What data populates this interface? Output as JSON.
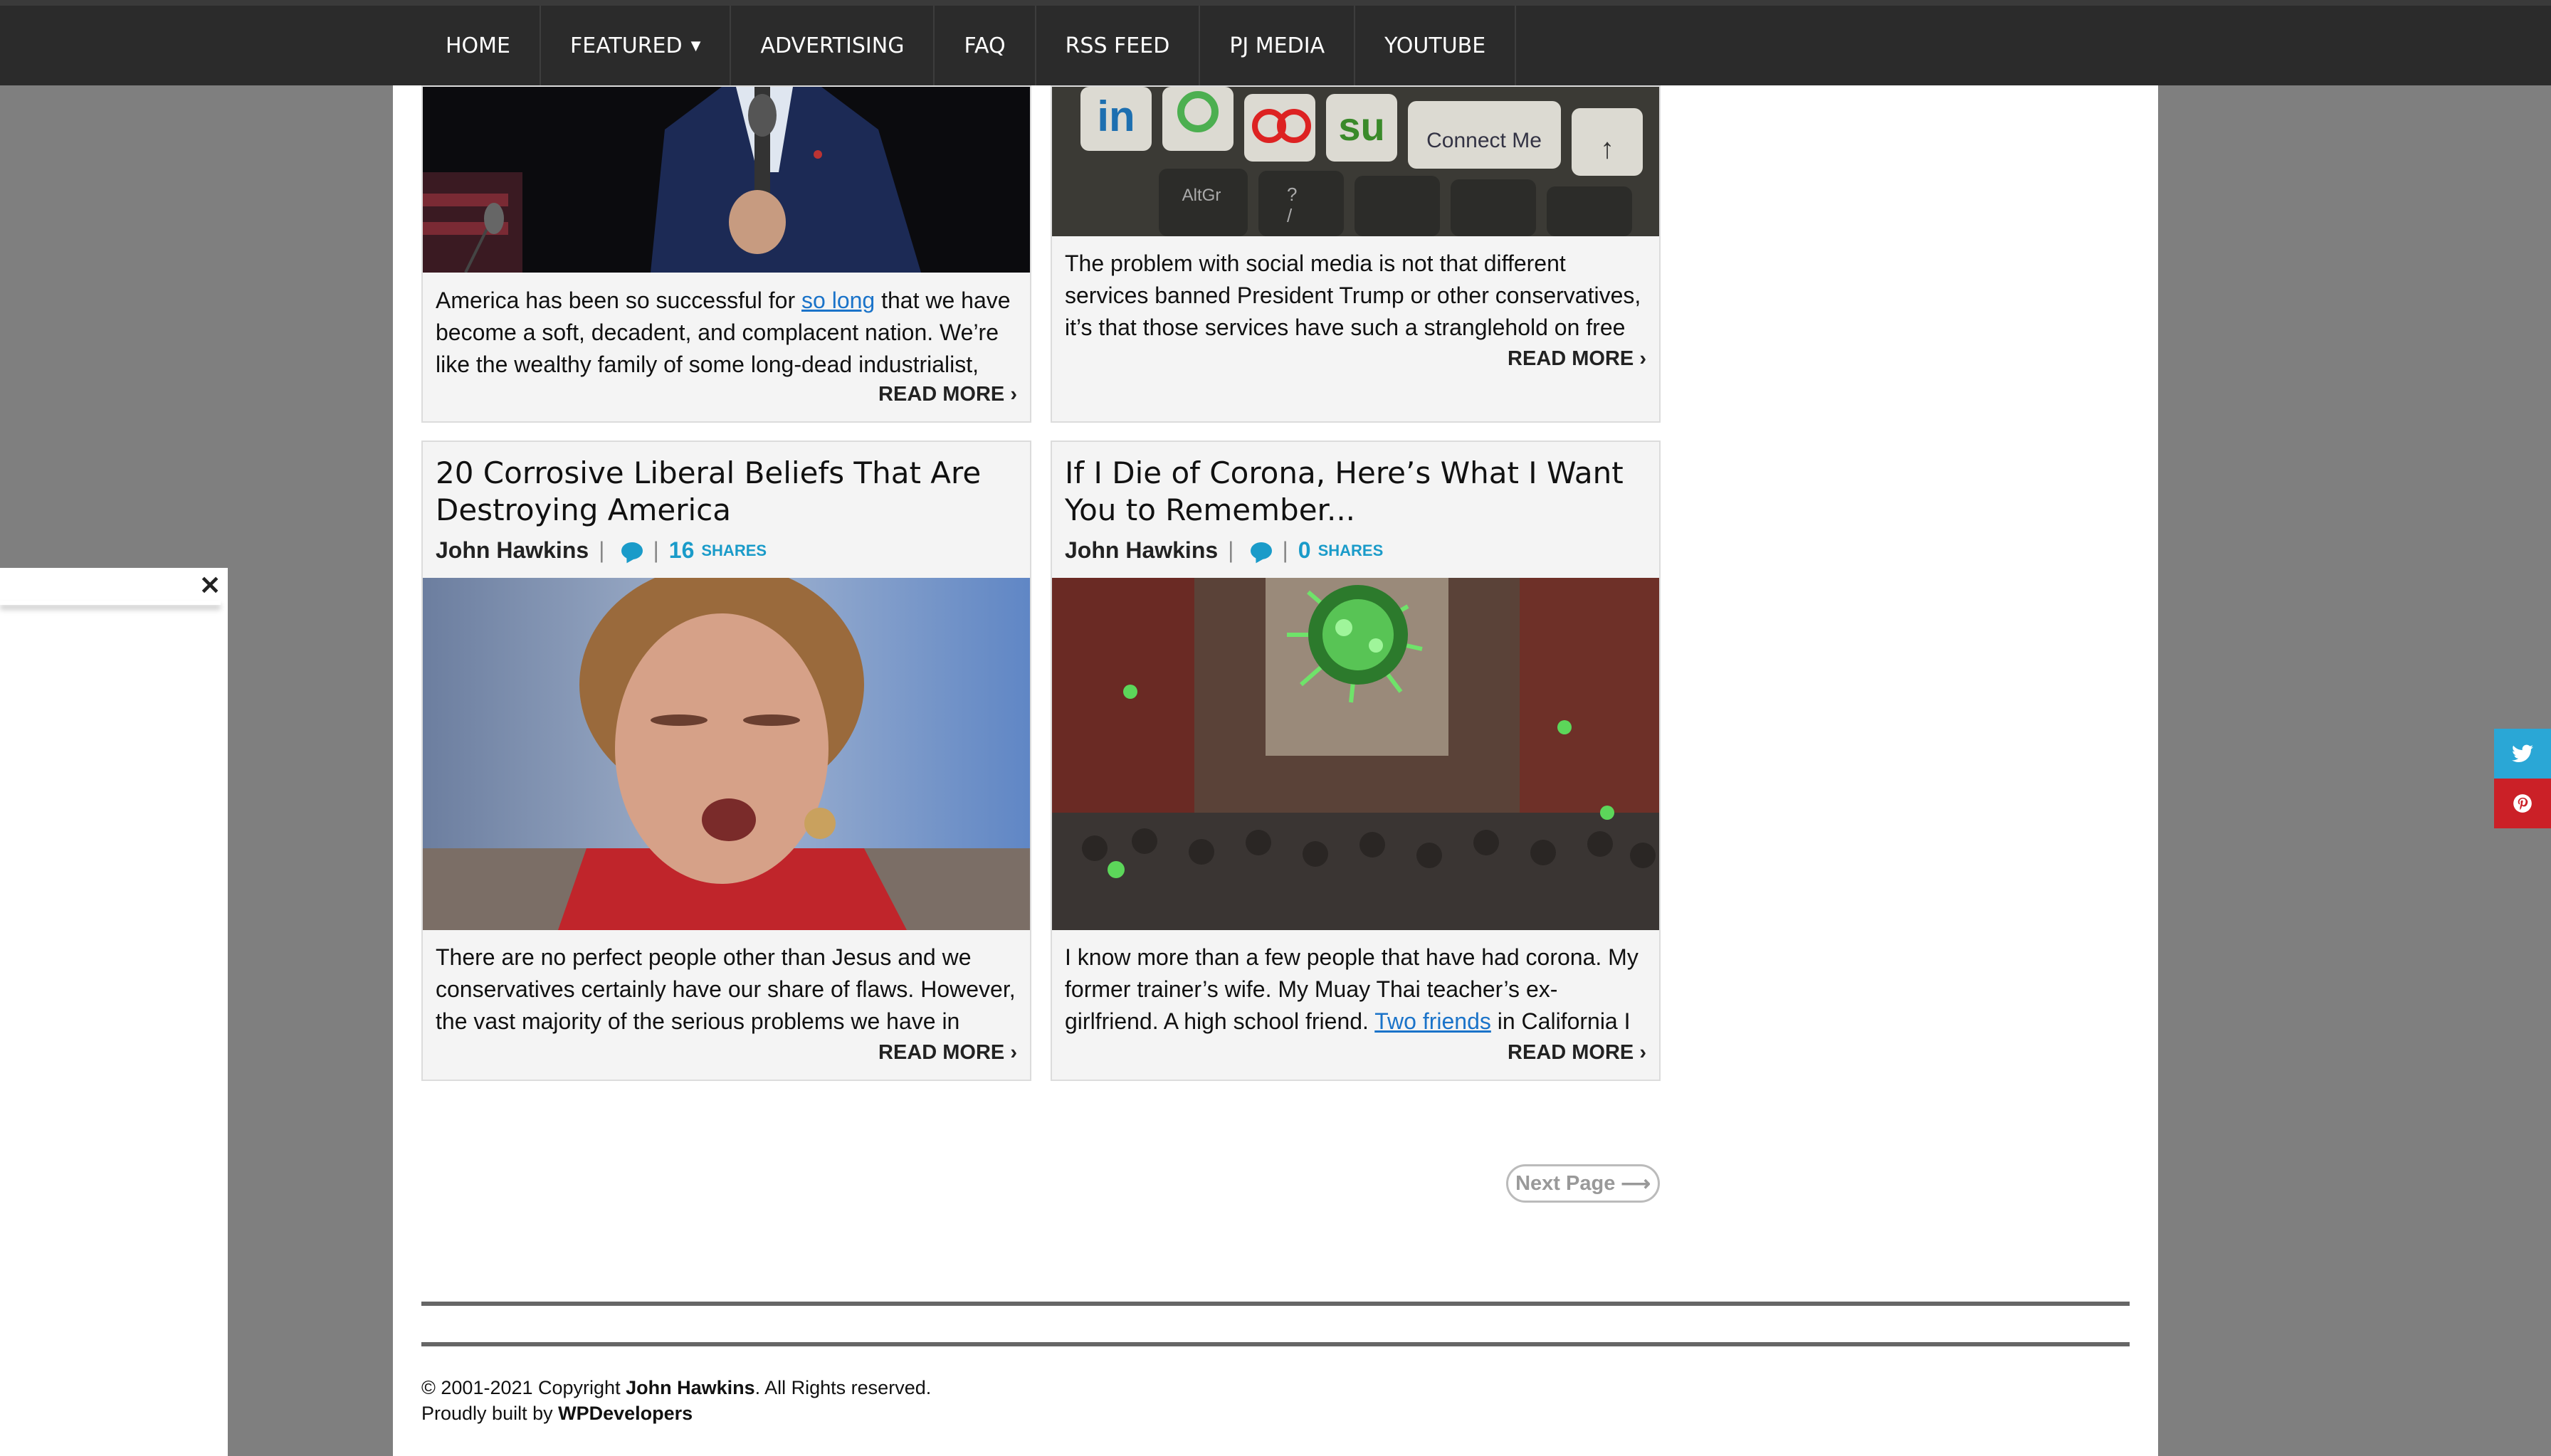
{
  "nav": {
    "items": [
      "HOME",
      "FEATURED",
      "ADVERTISING",
      "FAQ",
      "RSS FEED",
      "PJ MEDIA",
      "YOUTUBE"
    ]
  },
  "cards": [
    {
      "excerpt_before": "America has been so successful for ",
      "excerpt_link": "so long",
      "excerpt_after": " that we have become a soft, decadent, and complacent nation. We’re like the wealthy family of some long-dead industrialist,",
      "read_more": "READ MORE"
    },
    {
      "keys": [
        "in",
        "AltGr",
        "?",
        "/",
        "Connect Me"
      ],
      "excerpt": "The problem with social media is not that different services banned President Trump or other conservatives, it’s that those services have such a stranglehold on free",
      "read_more": "READ MORE"
    },
    {
      "title": "20 Corrosive Liberal Beliefs That Are Destroying America",
      "author": "John Hawkins",
      "shares_count": "16",
      "shares_label": "SHARES",
      "excerpt": "There are no perfect people other than Jesus and we conservatives certainly have our share of flaws. However, the vast majority of the serious problems we have in",
      "read_more": "READ MORE"
    },
    {
      "title": "If I Die of Corona, Here’s What I Want You to Remember...",
      "author": "John Hawkins",
      "shares_count": "0",
      "shares_label": "SHARES",
      "excerpt_before": "I know more than a few people that have had corona. My former trainer’s wife. My Muay Thai teacher’s ex-girlfriend. A high school friend. ",
      "excerpt_link": "Two friends",
      "excerpt_after": " in California I",
      "read_more": "READ MORE"
    }
  ],
  "pagination": {
    "next_label": "Next Page"
  },
  "footer": {
    "copyright_prefix": "© 2001-2021 Copyright ",
    "copyright_owner": "John Hawkins",
    "copyright_suffix": ". All Rights reserved.",
    "built_prefix": "Proudly built by ",
    "built_by": "WPDevelopers"
  },
  "colors": {
    "accent": "#1a9bc9",
    "twitter": "#2aa7d6",
    "pinterest": "#cb2027"
  }
}
